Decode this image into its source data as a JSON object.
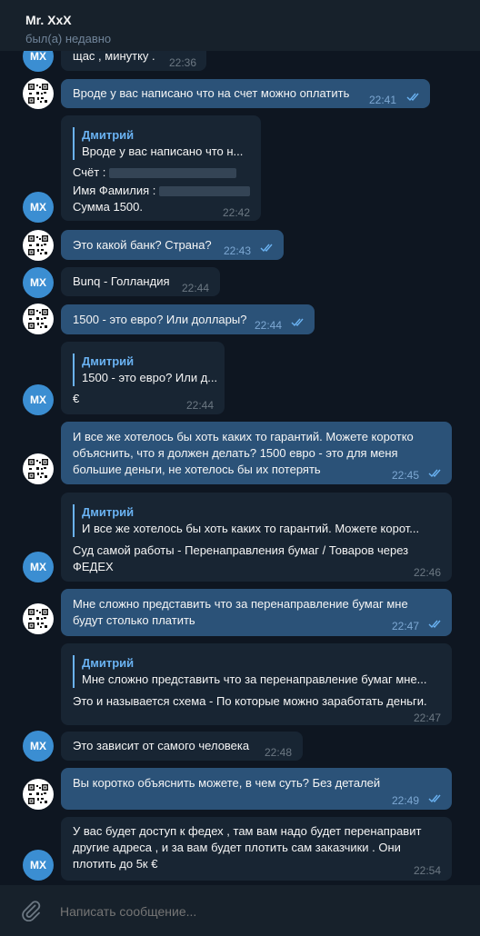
{
  "chat": {
    "title": "Mr. XxX",
    "status": "был(а) недавно"
  },
  "avatars": {
    "peer_initials": "MX"
  },
  "messages": [
    {
      "from": "peer",
      "text": "щас , минутку .",
      "time": "22:36"
    },
    {
      "from": "me",
      "text": "Вроде у вас написано что на счет можно оплатить",
      "time": "22:41"
    },
    {
      "from": "peer",
      "reply_name": "Дмитрий",
      "reply_text": "Вроде у вас написано что н...",
      "lines": [
        "Счёт :",
        "Имя Фамилия :",
        "Сумма 1500."
      ],
      "time": "22:42"
    },
    {
      "from": "me",
      "text": "Это какой банк? Страна?",
      "time": "22:43"
    },
    {
      "from": "peer",
      "text": "Bunq - Голландия",
      "time": "22:44"
    },
    {
      "from": "me",
      "text": "1500 - это евро? Или доллары?",
      "time": "22:44"
    },
    {
      "from": "peer",
      "reply_name": "Дмитрий",
      "reply_text": "1500 - это евро? Или д...",
      "lines": [
        "€"
      ],
      "time": "22:44"
    },
    {
      "from": "me",
      "lines": [
        "И все же хотелось бы хоть каких то гарантий. Можете коротко",
        "объяснить, что я должен делать? 1500 евро - это для меня",
        "большие деньги, не хотелось бы их потерять"
      ],
      "time": "22:45"
    },
    {
      "from": "peer",
      "reply_name": "Дмитрий",
      "reply_text": "И все же хотелось бы хоть каких то гарантий. Можете корот...",
      "lines": [
        "Суд самой работы - Перенаправления бумаг / Товаров через",
        "ФЕДЕХ"
      ],
      "time": "22:46"
    },
    {
      "from": "me",
      "lines": [
        "Мне сложно представить что за перенаправление бумаг мне",
        "будут столько платить"
      ],
      "time": "22:47"
    },
    {
      "from": "peer",
      "reply_name": "Дмитрий",
      "reply_text": "Мне сложно представить что за перенаправление бумаг мне...",
      "lines": [
        "Это и называется схема - По которые можно заработать деньги."
      ],
      "time": "22:47"
    },
    {
      "from": "peer",
      "text": "Это зависит от самого человека",
      "time": "22:48"
    },
    {
      "from": "me",
      "text": "Вы коротко объяснить можете, в чем суть? Без деталей",
      "time": "22:49"
    },
    {
      "from": "peer",
      "lines": [
        "У вас будет доступ к федех , там вам надо будет перенаправит",
        "другие адреса , и за вам будет плотить сам заказчики . Они",
        "плотить до 5к €"
      ],
      "time": "22:54"
    }
  ],
  "composer": {
    "placeholder": "Написать сообщение..."
  },
  "icons": {
    "attach": "paperclip-icon",
    "read": "double-check-icon"
  },
  "colors": {
    "background": "#0e1621",
    "incoming": "#182533",
    "outgoing": "#2b5278",
    "accent": "#6ab2f2",
    "avatar": "#3b8ed2"
  }
}
